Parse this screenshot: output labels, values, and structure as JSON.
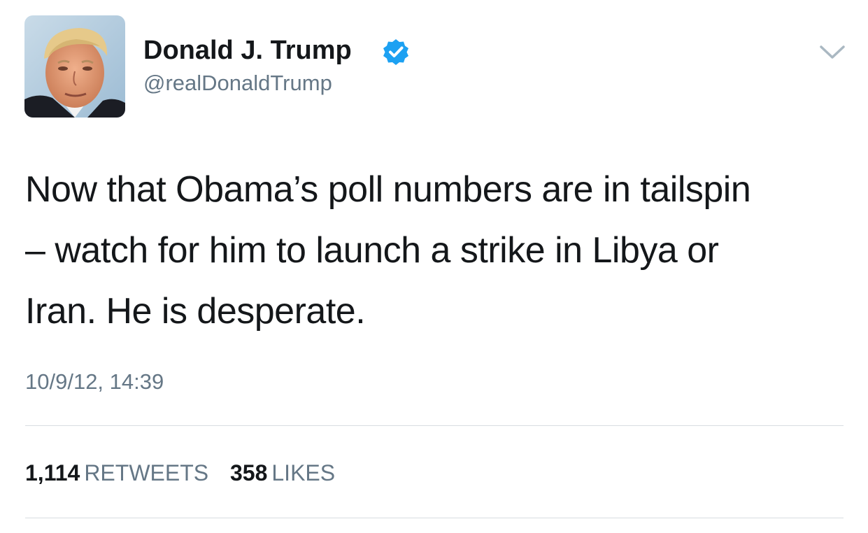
{
  "tweet": {
    "author": {
      "display_name": "Donald J. Trump",
      "handle": "@realDonaldTrump",
      "verified": true
    },
    "text": "Now that Obama’s poll numbers are in tailspin\n– watch for him to launch a strike in Libya or\nIran.  He is desperate.",
    "timestamp": "10/9/12, 14:39",
    "stats": {
      "retweets_count": "1,114",
      "retweets_label": "RETWEETS",
      "likes_count": "358",
      "likes_label": "LIKES"
    }
  },
  "icons": {
    "verified": "verified-badge-icon",
    "menu": "chevron-down-icon"
  },
  "colors": {
    "text_primary": "#14171a",
    "text_secondary": "#657786",
    "verified_blue": "#1da1f2",
    "divider": "#d8dde1"
  }
}
